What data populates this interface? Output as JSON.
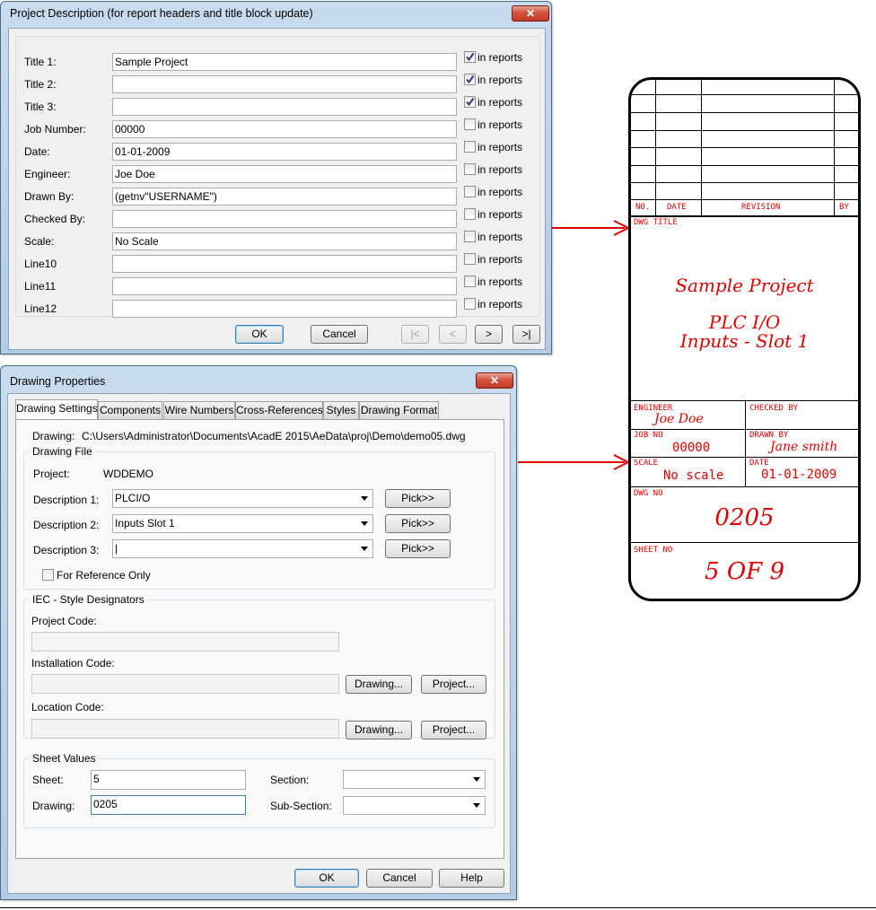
{
  "project_dialog": {
    "title": "Project Description  (for report headers and title block update)",
    "close": "✕",
    "rows": [
      {
        "label": "Title 1:",
        "value": "Sample Project",
        "in_reports": true
      },
      {
        "label": "Title 2:",
        "value": "",
        "in_reports": true
      },
      {
        "label": "Title 3:",
        "value": "",
        "in_reports": true
      },
      {
        "label": "Job Number:",
        "value": "00000",
        "in_reports": false
      },
      {
        "label": "Date:",
        "value": "01-01-2009",
        "in_reports": false
      },
      {
        "label": "Engineer:",
        "value": "Joe Doe",
        "in_reports": false
      },
      {
        "label": "Drawn By:",
        "value": "(getnv\"USERNAME\")",
        "in_reports": false
      },
      {
        "label": "Checked By:",
        "value": "",
        "in_reports": false
      },
      {
        "label": "Scale:",
        "value": "No Scale",
        "in_reports": false
      },
      {
        "label": "Line10",
        "value": "",
        "in_reports": false
      },
      {
        "label": "Line11",
        "value": "",
        "in_reports": false
      },
      {
        "label": "Line12",
        "value": "",
        "in_reports": false
      }
    ],
    "in_reports_label": "in reports",
    "ok": "OK",
    "cancel": "Cancel",
    "nav_first": "|<",
    "nav_prev": "<",
    "nav_next": ">",
    "nav_last": ">|"
  },
  "drawing_dialog": {
    "title": "Drawing Properties",
    "close": "✕",
    "tabs": [
      "Drawing Settings",
      "Components",
      "Wire Numbers",
      "Cross-References",
      "Styles",
      "Drawing Format"
    ],
    "drawing_label": "Drawing:",
    "drawing_path": "C:\\Users\\Administrator\\Documents\\AcadE 2015\\AeData\\proj\\Demo\\demo05.dwg",
    "drawing_file_group": "Drawing File",
    "project_label": "Project:",
    "project_value": "WDDEMO",
    "desc1_label": "Description 1:",
    "desc1_value": "PLCI/O",
    "desc2_label": "Description 2:",
    "desc2_value": "Inputs Slot 1",
    "desc3_label": "Description 3:",
    "desc3_value": "|",
    "pick": "Pick>>",
    "for_reference_only": "For Reference Only",
    "iec_group": "IEC - Style Designators",
    "project_code_label": "Project Code:",
    "installation_code_label": "Installation Code:",
    "location_code_label": "Location Code:",
    "drawing_btn": "Drawing...",
    "project_btn": "Project...",
    "sheet_values_group": "Sheet Values",
    "sheet_label": "Sheet:",
    "sheet_value": "5",
    "drawing_num_label": "Drawing:",
    "drawing_num_value": "0205",
    "section_label": "Section:",
    "subsection_label": "Sub-Section:",
    "ok": "OK",
    "cancel": "Cancel",
    "help": "Help"
  },
  "title_block": {
    "rev_headers": [
      "NO.",
      "DATE",
      "REVISION",
      "BY"
    ],
    "dwg_title_label": "DWG TITLE",
    "title_line1": "Sample Project",
    "title_line2": "PLC I/O",
    "title_line3": "Inputs - Slot 1",
    "engineer_label": "ENGINEER",
    "engineer_value": "Joe Doe",
    "checked_by_label": "CHECKED BY",
    "job_no_label": "JOB NO",
    "job_no_value": "00000",
    "drawn_by_label": "DRAWN BY",
    "drawn_by_value": "Jane smith",
    "scale_label": "SCALE",
    "scale_value": "No scale",
    "date_label": "DATE",
    "date_value": "01-01-2009",
    "dwg_no_label": "DWG NO",
    "dwg_no_value": "0205",
    "sheet_no_label": "SHEET NO",
    "sheet_no_value": "5 OF 9"
  },
  "colors": {
    "arrow": "#e00000",
    "title_block_text": "#e00000",
    "dialog_frame": "#b4cbe4"
  }
}
